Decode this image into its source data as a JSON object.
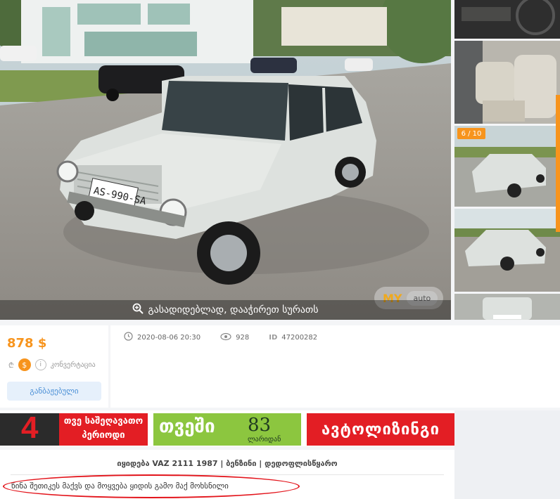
{
  "gallery": {
    "zoom_hint": "გასადიდებლად, დააჭირეთ სურათს",
    "watermark_brand": "MY",
    "watermark_sub": "auto",
    "counter": "6 / 10",
    "plate_text": "AS-990-SA",
    "thumbnails": [
      "dashboard",
      "seats",
      "front-three-quarter",
      "rear-three-quarter",
      "rear"
    ]
  },
  "price": {
    "amount": "878",
    "currency": "$",
    "currency_toggle_icon": "$",
    "gel_toggle_icon": "₾",
    "converter_label": "კონვერტაცია"
  },
  "customs_button": "განბაჟებული",
  "meta": {
    "date": "2020-08-06 20:30",
    "views": "928",
    "id_label": "ID",
    "id_value": "47200282"
  },
  "banner": {
    "ad1_number": "4",
    "ad1_line1": "თვე საშეღავათო",
    "ad1_line2": "პერიოდი",
    "ad2_word": "თვეში",
    "ad2_amount": "83",
    "ad2_sub": "ლარიდან",
    "ad3_text": "ავტოლიზინგი"
  },
  "listing": {
    "title": "იყიდება VAZ 2111 1987 | ბენზინი | დედოფლისწყარო",
    "description": "წინა შეთიკეს მაქვს და მოყვება ყიდის გამო მაქ მოხსნილი"
  },
  "colors": {
    "accent": "#f7941d",
    "ad_red": "#e31e24",
    "ad_green": "#8cc63f",
    "annotation_red": "#e3141b"
  }
}
